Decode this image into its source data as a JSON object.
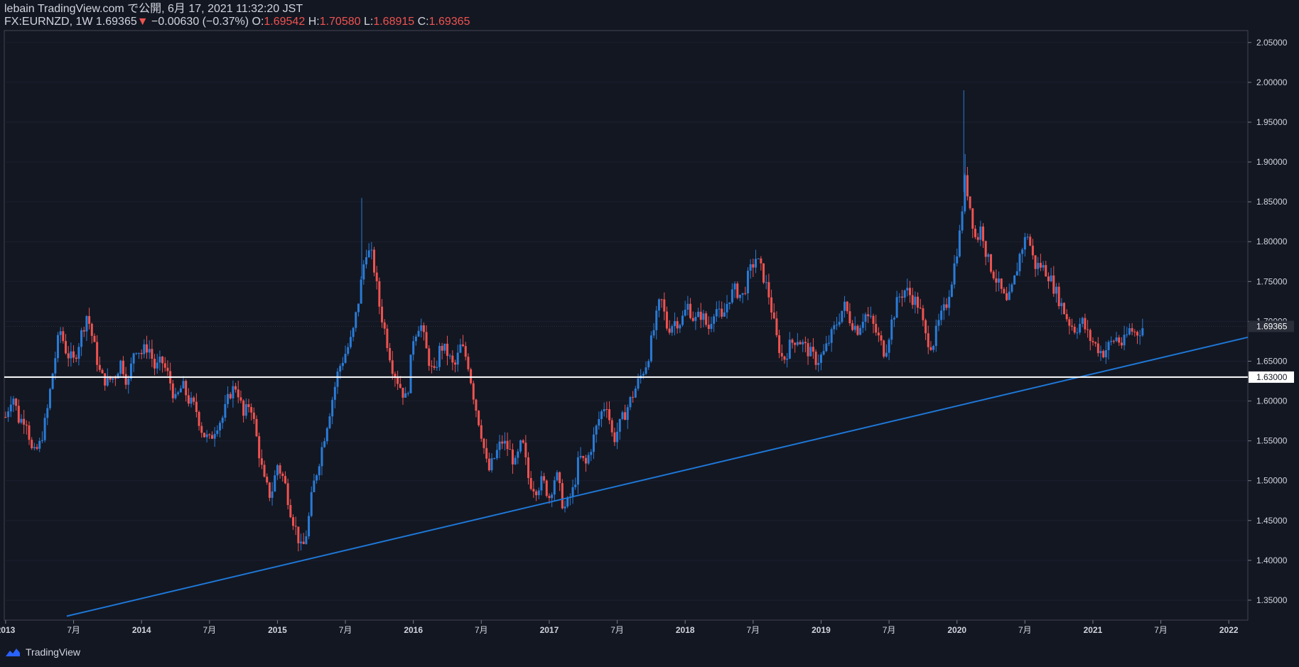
{
  "header": {
    "publish_line": "lebain TradingView.com で公開, 6月 17, 2021 11:32:20 JST",
    "symbol": "FX:EURNZD",
    "interval": "1W",
    "last": "1.69365",
    "change": "−0.00630 (−0.37%)",
    "open_label": "O:",
    "open": "1.69542",
    "high_label": "H:",
    "high": "1.70580",
    "low_label": "L:",
    "low": "1.68915",
    "close_label": "C:",
    "close": "1.69365"
  },
  "footer": {
    "brand": "TradingView"
  },
  "colors": {
    "bg": "#131722",
    "up": "#2962ff",
    "up_candle": "#2a7bd6",
    "down": "#ef5350",
    "line": "#1e78d8",
    "support": "#ffffff",
    "text": "#d1d4dc"
  },
  "chart_data": {
    "type": "candlestick",
    "title": "FX:EURNZD 1W",
    "x_labels": [
      "2013",
      "7月",
      "2014",
      "7月",
      "2015",
      "7月",
      "2016",
      "7月",
      "2017",
      "7月",
      "2018",
      "7月",
      "2019",
      "7月",
      "2020",
      "7月",
      "2021",
      "7月",
      "2022"
    ],
    "x_label_years": [
      2013.0,
      2013.5,
      2014.0,
      2014.5,
      2015.0,
      2015.5,
      2016.0,
      2016.5,
      2017.0,
      2017.5,
      2018.0,
      2018.5,
      2019.0,
      2019.5,
      2020.0,
      2020.5,
      2021.0,
      2021.5,
      2022.0
    ],
    "y_ticks": [
      "1.35000",
      "1.40000",
      "1.45000",
      "1.50000",
      "1.55000",
      "1.60000",
      "1.65000",
      "1.70000",
      "1.75000",
      "1.80000",
      "1.85000",
      "1.90000",
      "1.95000",
      "2.00000",
      "2.05000"
    ],
    "ylim": [
      1.325,
      2.065
    ],
    "xlim": [
      2012.99,
      2022.14
    ],
    "last_price": "1.69365",
    "support_level": {
      "value": 1.63,
      "label": "1.63000"
    },
    "trendline": {
      "start": [
        2013.45,
        1.33
      ],
      "end": [
        2022.14,
        1.68
      ]
    },
    "close_path": [
      [
        2013.0,
        1.58
      ],
      [
        2013.05,
        1.61
      ],
      [
        2013.1,
        1.575
      ],
      [
        2013.15,
        1.58
      ],
      [
        2013.2,
        1.53
      ],
      [
        2013.25,
        1.545
      ],
      [
        2013.3,
        1.58
      ],
      [
        2013.35,
        1.64
      ],
      [
        2013.4,
        1.69
      ],
      [
        2013.45,
        1.66
      ],
      [
        2013.5,
        1.65
      ],
      [
        2013.55,
        1.68
      ],
      [
        2013.6,
        1.71
      ],
      [
        2013.65,
        1.67
      ],
      [
        2013.7,
        1.63
      ],
      [
        2013.75,
        1.625
      ],
      [
        2013.8,
        1.63
      ],
      [
        2013.85,
        1.65
      ],
      [
        2013.9,
        1.62
      ],
      [
        2013.95,
        1.67
      ],
      [
        2014.0,
        1.66
      ],
      [
        2014.05,
        1.67
      ],
      [
        2014.1,
        1.64
      ],
      [
        2014.15,
        1.65
      ],
      [
        2014.2,
        1.63
      ],
      [
        2014.25,
        1.6
      ],
      [
        2014.3,
        1.62
      ],
      [
        2014.35,
        1.6
      ],
      [
        2014.4,
        1.59
      ],
      [
        2014.45,
        1.56
      ],
      [
        2014.5,
        1.55
      ],
      [
        2014.55,
        1.57
      ],
      [
        2014.6,
        1.58
      ],
      [
        2014.65,
        1.61
      ],
      [
        2014.7,
        1.62
      ],
      [
        2014.75,
        1.58
      ],
      [
        2014.8,
        1.6
      ],
      [
        2014.85,
        1.55
      ],
      [
        2014.9,
        1.5
      ],
      [
        2014.95,
        1.48
      ],
      [
        2015.0,
        1.52
      ],
      [
        2015.05,
        1.5
      ],
      [
        2015.1,
        1.46
      ],
      [
        2015.15,
        1.43
      ],
      [
        2015.18,
        1.41
      ],
      [
        2015.22,
        1.44
      ],
      [
        2015.26,
        1.49
      ],
      [
        2015.3,
        1.52
      ],
      [
        2015.35,
        1.56
      ],
      [
        2015.4,
        1.6
      ],
      [
        2015.45,
        1.64
      ],
      [
        2015.5,
        1.66
      ],
      [
        2015.55,
        1.68
      ],
      [
        2015.6,
        1.73
      ],
      [
        2015.65,
        1.79
      ],
      [
        2015.7,
        1.78
      ],
      [
        2015.75,
        1.72
      ],
      [
        2015.8,
        1.68
      ],
      [
        2015.85,
        1.64
      ],
      [
        2015.9,
        1.62
      ],
      [
        2015.95,
        1.6
      ],
      [
        2016.0,
        1.68
      ],
      [
        2016.05,
        1.7
      ],
      [
        2016.1,
        1.66
      ],
      [
        2016.15,
        1.63
      ],
      [
        2016.2,
        1.67
      ],
      [
        2016.25,
        1.66
      ],
      [
        2016.3,
        1.64
      ],
      [
        2016.35,
        1.67
      ],
      [
        2016.4,
        1.65
      ],
      [
        2016.45,
        1.6
      ],
      [
        2016.5,
        1.56
      ],
      [
        2016.55,
        1.51
      ],
      [
        2016.6,
        1.53
      ],
      [
        2016.65,
        1.55
      ],
      [
        2016.7,
        1.54
      ],
      [
        2016.75,
        1.52
      ],
      [
        2016.8,
        1.55
      ],
      [
        2016.85,
        1.5
      ],
      [
        2016.9,
        1.49
      ],
      [
        2016.95,
        1.5
      ],
      [
        2017.0,
        1.48
      ],
      [
        2017.05,
        1.51
      ],
      [
        2017.1,
        1.47
      ],
      [
        2017.12,
        1.465
      ],
      [
        2017.18,
        1.49
      ],
      [
        2017.22,
        1.53
      ],
      [
        2017.27,
        1.52
      ],
      [
        2017.32,
        1.55
      ],
      [
        2017.37,
        1.58
      ],
      [
        2017.42,
        1.6
      ],
      [
        2017.47,
        1.55
      ],
      [
        2017.52,
        1.57
      ],
      [
        2017.57,
        1.59
      ],
      [
        2017.62,
        1.61
      ],
      [
        2017.67,
        1.63
      ],
      [
        2017.72,
        1.65
      ],
      [
        2017.77,
        1.69
      ],
      [
        2017.82,
        1.73
      ],
      [
        2017.87,
        1.69
      ],
      [
        2017.92,
        1.7
      ],
      [
        2017.97,
        1.7
      ],
      [
        2018.02,
        1.72
      ],
      [
        2018.07,
        1.7
      ],
      [
        2018.12,
        1.71
      ],
      [
        2018.17,
        1.69
      ],
      [
        2018.22,
        1.72
      ],
      [
        2018.27,
        1.7
      ],
      [
        2018.32,
        1.73
      ],
      [
        2018.37,
        1.74
      ],
      [
        2018.42,
        1.73
      ],
      [
        2018.47,
        1.76
      ],
      [
        2018.52,
        1.78
      ],
      [
        2018.57,
        1.76
      ],
      [
        2018.62,
        1.73
      ],
      [
        2018.67,
        1.68
      ],
      [
        2018.72,
        1.65
      ],
      [
        2018.77,
        1.67
      ],
      [
        2018.82,
        1.68
      ],
      [
        2018.87,
        1.67
      ],
      [
        2018.92,
        1.66
      ],
      [
        2018.97,
        1.65
      ],
      [
        2019.02,
        1.66
      ],
      [
        2019.07,
        1.68
      ],
      [
        2019.12,
        1.7
      ],
      [
        2019.17,
        1.72
      ],
      [
        2019.22,
        1.7
      ],
      [
        2019.27,
        1.69
      ],
      [
        2019.32,
        1.71
      ],
      [
        2019.37,
        1.7
      ],
      [
        2019.42,
        1.68
      ],
      [
        2019.47,
        1.66
      ],
      [
        2019.52,
        1.7
      ],
      [
        2019.57,
        1.73
      ],
      [
        2019.62,
        1.74
      ],
      [
        2019.67,
        1.73
      ],
      [
        2019.72,
        1.72
      ],
      [
        2019.77,
        1.68
      ],
      [
        2019.82,
        1.67
      ],
      [
        2019.87,
        1.7
      ],
      [
        2019.92,
        1.72
      ],
      [
        2019.97,
        1.76
      ],
      [
        2020.02,
        1.81
      ],
      [
        2020.06,
        1.88
      ],
      [
        2020.1,
        1.84
      ],
      [
        2020.14,
        1.8
      ],
      [
        2020.18,
        1.82
      ],
      [
        2020.22,
        1.78
      ],
      [
        2020.27,
        1.76
      ],
      [
        2020.32,
        1.74
      ],
      [
        2020.37,
        1.72
      ],
      [
        2020.42,
        1.75
      ],
      [
        2020.47,
        1.79
      ],
      [
        2020.52,
        1.81
      ],
      [
        2020.57,
        1.77
      ],
      [
        2020.62,
        1.77
      ],
      [
        2020.67,
        1.76
      ],
      [
        2020.72,
        1.74
      ],
      [
        2020.77,
        1.72
      ],
      [
        2020.82,
        1.7
      ],
      [
        2020.87,
        1.69
      ],
      [
        2020.92,
        1.7
      ],
      [
        2020.97,
        1.68
      ],
      [
        2021.02,
        1.67
      ],
      [
        2021.07,
        1.66
      ],
      [
        2021.12,
        1.67
      ],
      [
        2021.17,
        1.68
      ],
      [
        2021.22,
        1.67
      ],
      [
        2021.27,
        1.69
      ],
      [
        2021.32,
        1.685
      ],
      [
        2021.37,
        1.693
      ]
    ],
    "wick_spikes": [
      {
        "x": 2015.62,
        "high": 1.855
      },
      {
        "x": 2020.05,
        "high": 1.99
      },
      {
        "x": 2020.06,
        "high": 1.91
      }
    ]
  }
}
